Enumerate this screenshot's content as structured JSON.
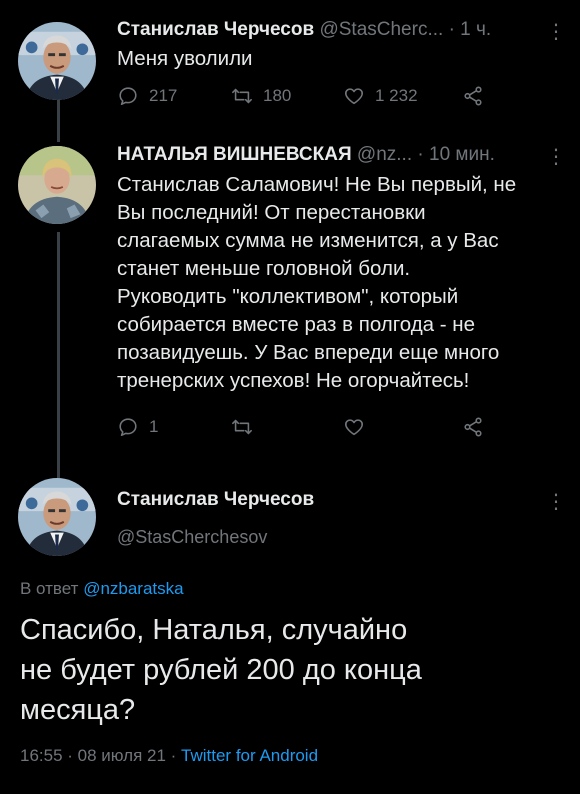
{
  "tweet1": {
    "author_name": "Станислав Черчесов",
    "handle": "@StasCherc...",
    "time": "1 ч.",
    "text": "Меня уволили",
    "replies": "217",
    "retweets": "180",
    "likes": "1 232"
  },
  "tweet2": {
    "author_name": "НАТАЛЬЯ ВИШНЕВСКАЯ",
    "handle": "@nz...",
    "time": "10 мин.",
    "text_lines": [
      "Станислав Саламович! Не Вы первый, не",
      "Вы последний! От перестановки",
      "слагаемых сумма не изменится, а у Вас",
      "станет меньше головной боли.",
      "Руководить \"коллективом\", который",
      "собирается вместе раз в полгода - не",
      "позавидуешь. У Вас впереди еще много",
      "тренерских успехов! Не огорчайтесь!"
    ],
    "replies": "1"
  },
  "main_tweet": {
    "author_name": "Станислав Черчесов",
    "handle": "@StasCherchesov",
    "reply_prefix": "В ответ",
    "reply_to": "@nzbaratska",
    "text_lines": [
      "Спасибо, Наталья, случайно",
      "не будет рублей 200 до конца",
      "месяца?"
    ],
    "timestamp": "16:55 · 08 июля 21 ·",
    "source": "Twitter for Android"
  },
  "icons": {
    "reply": "reply-icon",
    "retweet": "retweet-icon",
    "like": "heart-icon",
    "share": "share-icon",
    "more": "more-icon"
  },
  "colors": {
    "background": "#000000",
    "text": "#e7e9ea",
    "muted": "#71767b",
    "link": "#1d9bf0"
  }
}
